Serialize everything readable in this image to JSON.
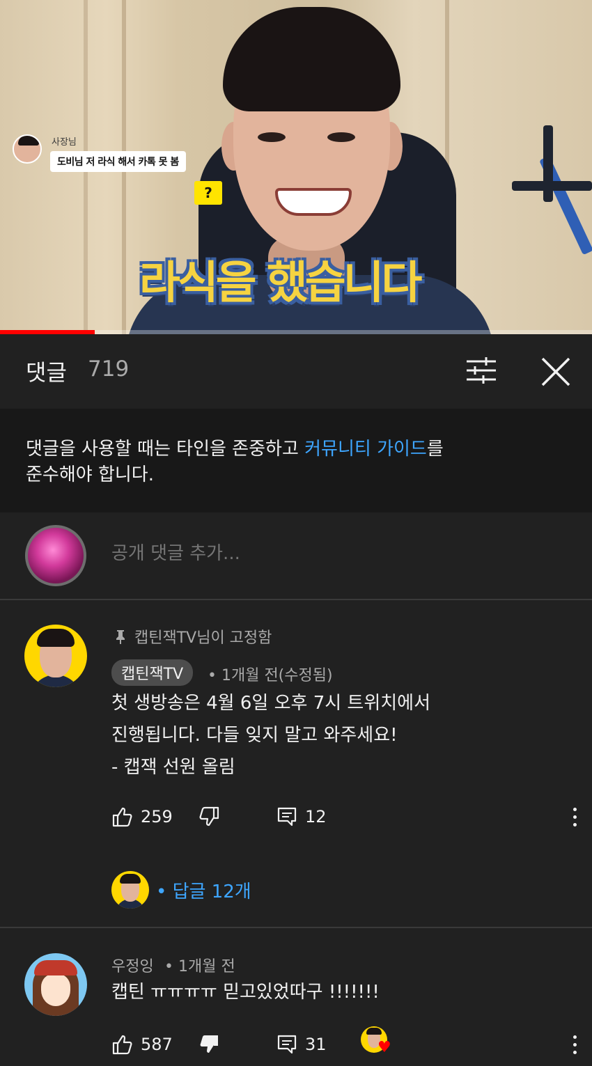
{
  "video": {
    "overlay_name": "사장님",
    "overlay_message": "도비님 저 라식 해서 카톡 못 봄",
    "question_badge": "?",
    "caption": "라식을 했습니다",
    "progress_fraction": 0.16
  },
  "header": {
    "title": "댓글",
    "count": "719",
    "icons": {
      "filter": "sort-filter-icon",
      "close": "close-icon"
    }
  },
  "notice": {
    "text_before": "댓글을 사용할 때는 타인을 존중하고 ",
    "link": "커뮤니티 가이드",
    "text_after": "를\n준수해야 합니다."
  },
  "add_comment": {
    "placeholder": "공개 댓글 추가..."
  },
  "comments": [
    {
      "pinned_label": "캡틴잭TV님이 고정함",
      "author": "캡틴잭TV",
      "time": "• 1개월 전(수정됨)",
      "body": "첫 생방송은 4월 6일 오후 7시 트위치에서\n진행됩니다. 다들 잊지 말고 와주세요!\n- 캡잭 선원 올림",
      "likes": "259",
      "replies": "12",
      "replies_link": "• 답글 12개"
    },
    {
      "author": "우정잉",
      "time": "• 1개월 전",
      "body": "캡틴 ㅠㅠㅠㅠ 믿고있었따구 !!!!!!!",
      "likes": "587",
      "replies": "31",
      "hearted": true
    }
  ],
  "colors": {
    "background": "#212121",
    "link": "#3ea6ff",
    "secondary_text": "#aaaaaa",
    "progress": "#ff0000"
  }
}
